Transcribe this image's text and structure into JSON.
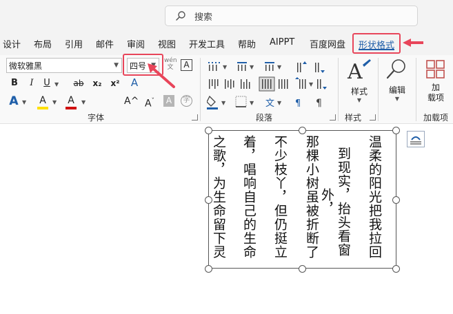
{
  "search": {
    "placeholder": "搜索"
  },
  "tabs": [
    {
      "label": "设计"
    },
    {
      "label": "布局"
    },
    {
      "label": "引用"
    },
    {
      "label": "邮件"
    },
    {
      "label": "审阅"
    },
    {
      "label": "视图"
    },
    {
      "label": "开发工具"
    },
    {
      "label": "帮助"
    },
    {
      "label": "AIPPT"
    },
    {
      "label": "百度网盘"
    },
    {
      "label": "形状格式",
      "active": true
    }
  ],
  "font_group": {
    "font_name": "微软雅黑",
    "font_size": "四号",
    "label": "字体",
    "bold": "B",
    "italic": "I",
    "underline": "U",
    "strike": "ab",
    "subscript": "x₂",
    "superscript": "x²",
    "text_effect": "A",
    "highlight": "A",
    "font_color": "A",
    "grow": "A^",
    "shrink": "A",
    "char_shade": "A",
    "phonetic_top": "wén",
    "phonetic_bottom": "文",
    "enclose": "字",
    "char_border": "A"
  },
  "paragraph_group": {
    "label": "段落"
  },
  "style_group": {
    "label": "样式",
    "button": "样式"
  },
  "edit_group": {
    "button": "编辑"
  },
  "addin_group": {
    "button_line1": "加",
    "button_line2": "载项",
    "label": "加载项"
  },
  "colors": {
    "accent_red": "#e8455a",
    "accent_blue": "#1f5ea8",
    "highlight_yellow": "#ffe000",
    "font_red": "#d01010",
    "ribbon_bg": "#f9f9f9",
    "topbar_bg": "#f3f3f3"
  },
  "document": {
    "columns": [
      "温柔的阳光把我拉回",
      "到现实，抬头看窗外，",
      "那棵小树虽被折断了",
      "不少枝丫，但仍挺立",
      "着，唱响自己的生命",
      "之歌，为生命留下灵"
    ]
  }
}
